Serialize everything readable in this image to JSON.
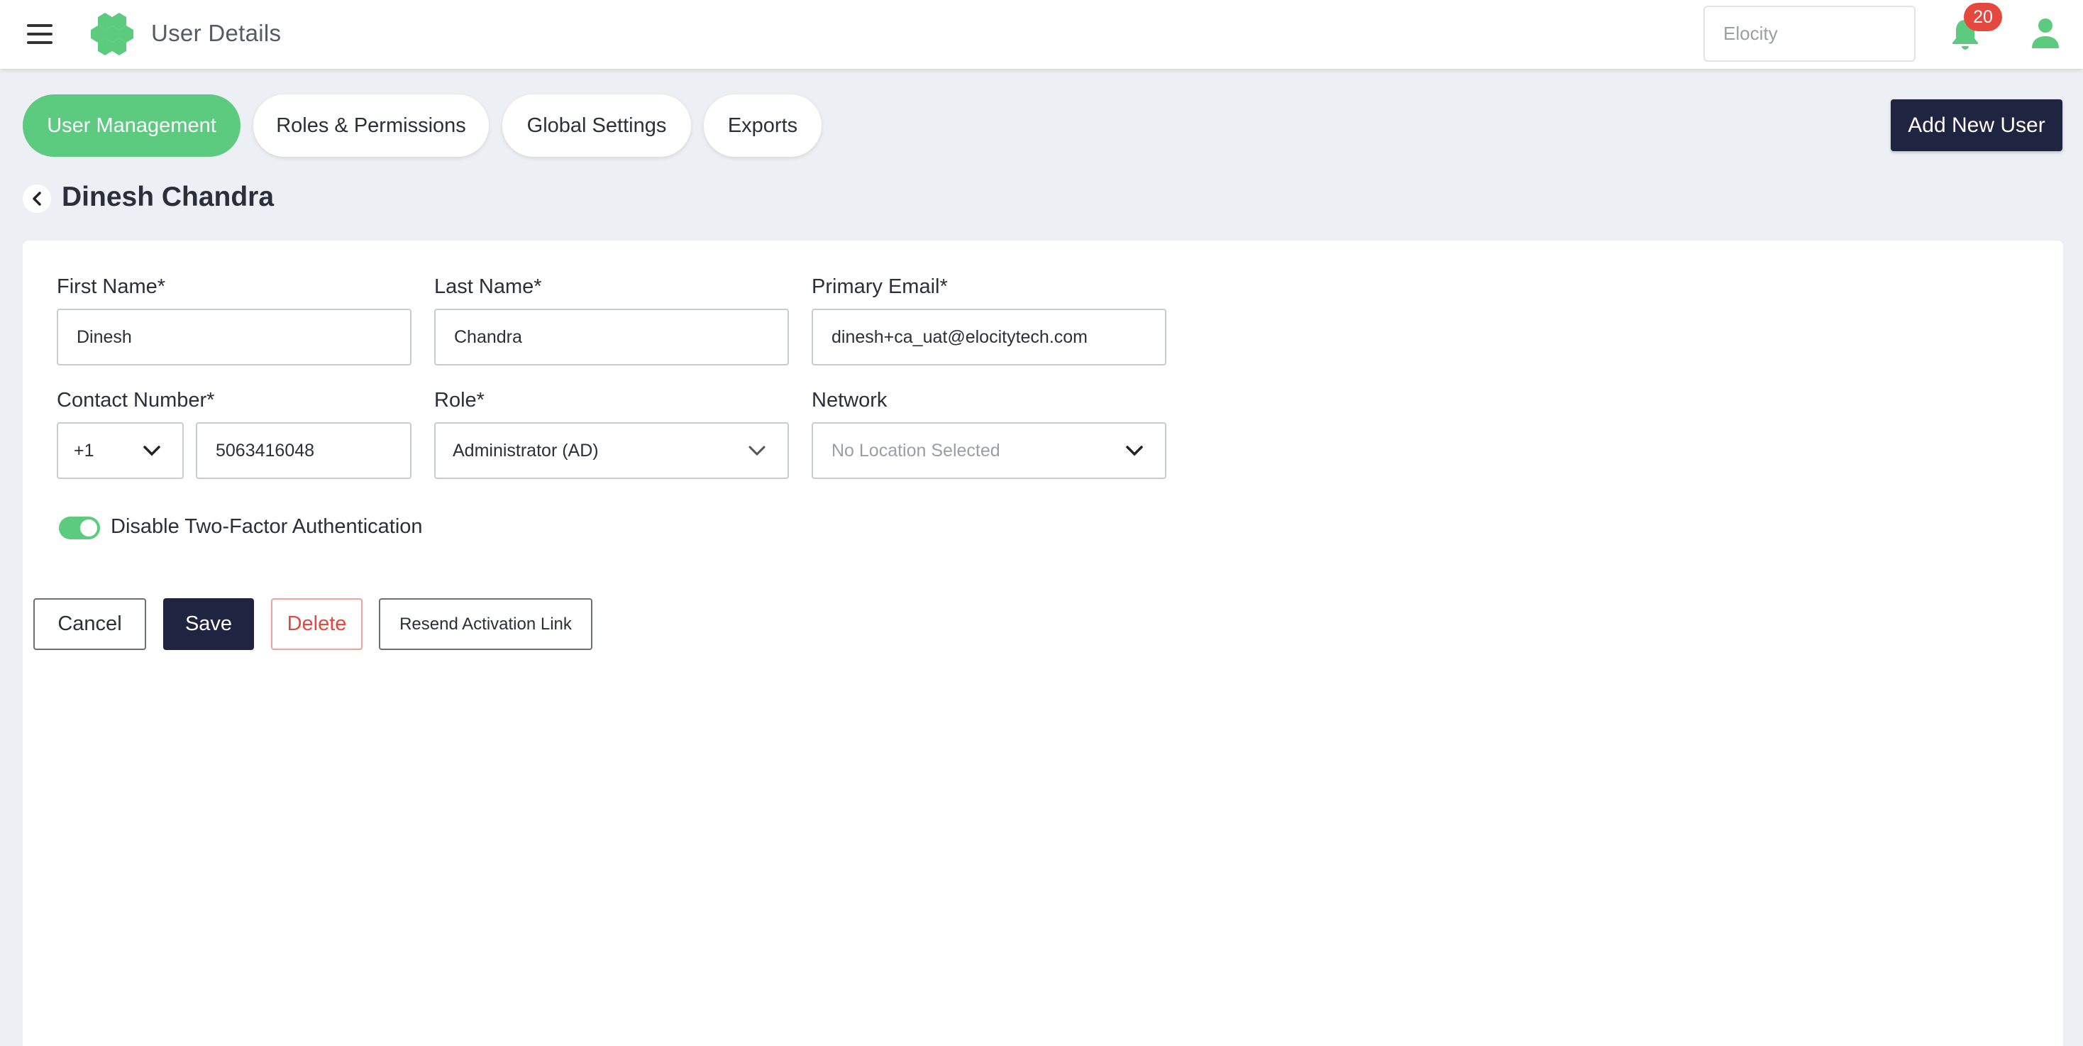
{
  "header": {
    "title": "User Details",
    "org_selector": "Elocity",
    "notification_count": "20",
    "icons": [
      "menu-icon",
      "logo",
      "bell-icon",
      "user-icon"
    ]
  },
  "tabs": [
    {
      "label": "User Management",
      "active": true
    },
    {
      "label": "Roles & Permissions",
      "active": false
    },
    {
      "label": "Global Settings",
      "active": false
    },
    {
      "label": "Exports",
      "active": false
    }
  ],
  "actions": {
    "add_user": "Add New User"
  },
  "page": {
    "title": "Dinesh Chandra"
  },
  "form": {
    "first_name": {
      "label": "First Name*",
      "value": "Dinesh"
    },
    "last_name": {
      "label": "Last Name*",
      "value": "Chandra"
    },
    "primary_email": {
      "label": "Primary Email*",
      "value": "dinesh+ca_uat@elocitytech.com"
    },
    "contact_number": {
      "label": "Contact Number*",
      "country_code": "+1",
      "value": "5063416048"
    },
    "role": {
      "label": "Role*",
      "value": "Administrator (AD)"
    },
    "network": {
      "label": "Network",
      "placeholder": "No Location Selected"
    },
    "two_factor": {
      "label": "Disable Two-Factor Authentication",
      "enabled": true
    }
  },
  "buttons": {
    "cancel": "Cancel",
    "save": "Save",
    "delete": "Delete",
    "resend": "Resend Activation Link"
  },
  "colors": {
    "accent_green": "#5ccb80",
    "navy": "#1f2540",
    "danger": "#e4483f",
    "background": "#eceff3"
  }
}
